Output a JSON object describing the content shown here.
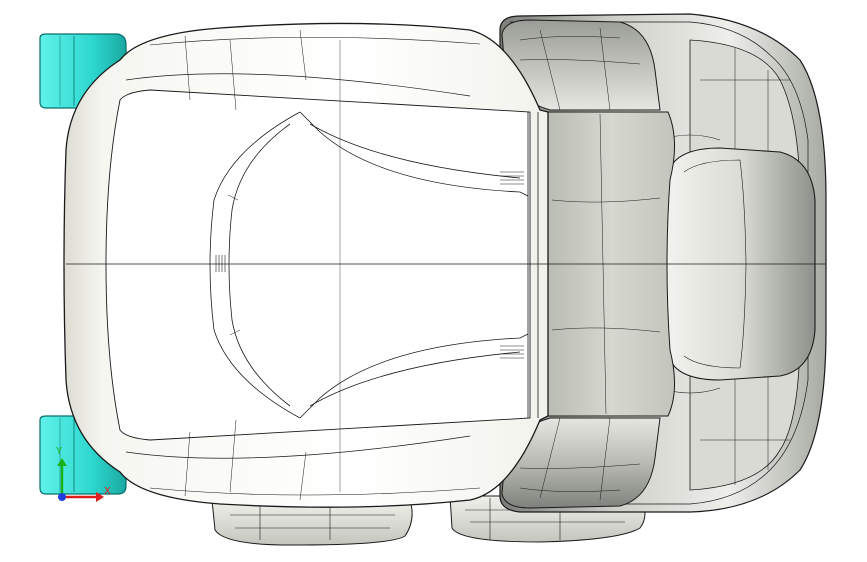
{
  "viewport": {
    "background": "#ffffff",
    "model_fill": "#f4f4ef",
    "model_shade": "#cfd1c9",
    "model_dark": "#8b8e88",
    "edge_color": "#1a1a1a",
    "bracket_fill": "#39e6dc",
    "bracket_edge": "#0a6f6a"
  },
  "triad": {
    "x_label": "X",
    "y_label": "Y",
    "x_color": "#e01e1e",
    "y_color": "#19b319",
    "z_color": "#1e3ee0"
  }
}
